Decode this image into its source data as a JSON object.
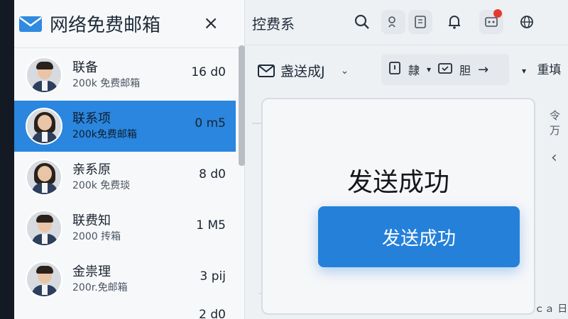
{
  "app": {
    "title": "网络免费邮箱",
    "close_glyph": "×"
  },
  "contacts": [
    {
      "name": "联备",
      "sub": "200k 免费邮箱",
      "time": "16 d0",
      "avatar": "male"
    },
    {
      "name": "联系项",
      "sub": "200k免费邮箱",
      "time": "0 m5",
      "avatar": "female"
    },
    {
      "name": "亲系原",
      "sub": "200k 免费琰",
      "time": "8 d0",
      "avatar": "female"
    },
    {
      "name": "联费知",
      "sub": "2000 抟箱",
      "time": "1 M5",
      "avatar": "male"
    },
    {
      "name": "金祟理",
      "sub": "200r.免邮箱",
      "time": "3 pij",
      "avatar": "male"
    },
    {
      "name": "",
      "sub": "",
      "time": "2 d0",
      "avatar": "male"
    }
  ],
  "topbar": {
    "title": "控费系",
    "icons": [
      "search-icon",
      "tag-icon",
      "notebook-icon",
      "bell-icon",
      "notification-icon",
      "globe-icon"
    ]
  },
  "toolbar": {
    "send_label": "盏送成J",
    "btn1_label": "隷",
    "btn2_label": "胆",
    "reset_label": "重填"
  },
  "side": {
    "label": "令 万",
    "arrow": "‹"
  },
  "dialog": {
    "title": "发送成功",
    "button_label": "发送成功"
  },
  "footer": {
    "bottom_right": "ｃａ 日"
  },
  "colors": {
    "accent": "#2580d9",
    "selected_row": "#2a86de",
    "badge": "#e23b2e"
  }
}
